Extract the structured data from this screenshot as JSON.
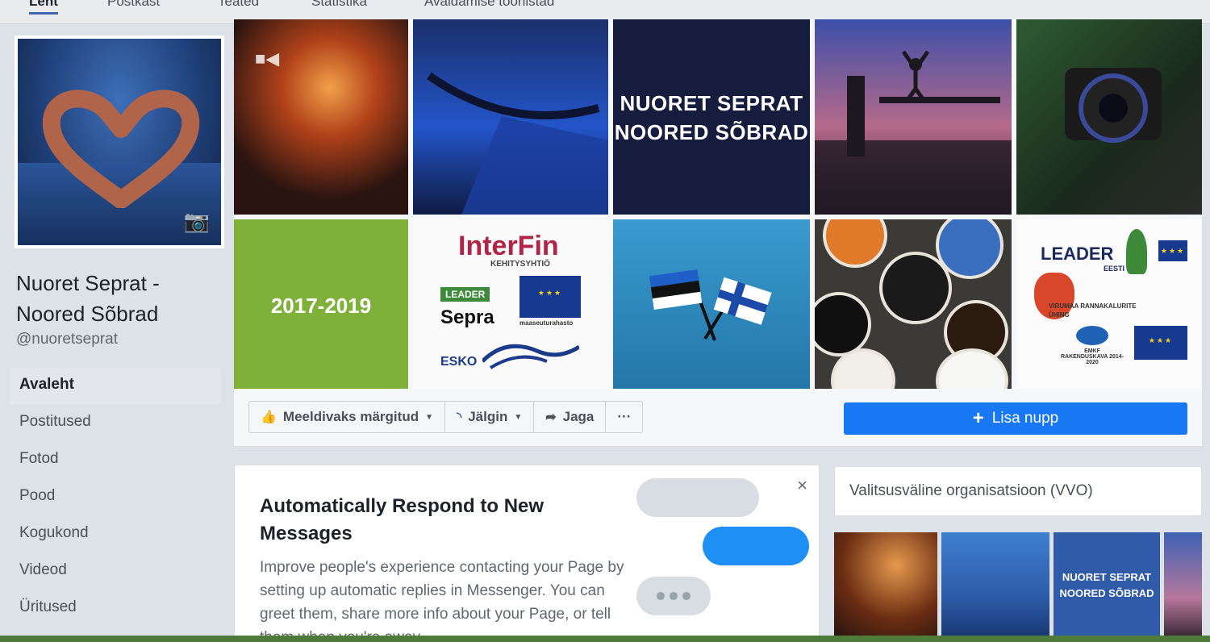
{
  "top_tabs": [
    "Lent",
    "Postkast",
    "Teated",
    "Statistika",
    "Avaldamise tööriistad"
  ],
  "page": {
    "name": "Nuoret Seprat - Noored Sõbrad",
    "handle": "@nuoretseprat"
  },
  "nav": [
    "Avaleht",
    "Postitused",
    "Fotod",
    "Pood",
    "Kogukond",
    "Videod",
    "Üritused"
  ],
  "cover": {
    "title_line1": "NUORET SEPRAT",
    "title_line2": "NOORED SÕBRAD",
    "years": "2017-2019",
    "logos": {
      "interfin": "InterFin",
      "interfin_sub": "KEHITYSYHTIÖ",
      "leader": "LEADER",
      "sepra": "Sepra",
      "eu_fund": "maaseuturahasto",
      "esko": "ESKO",
      "leader_eesti": "LEADER",
      "eesti": "EESTI",
      "virumaa": "VIRUMAA RANNAKALURITE ÜHING",
      "emkf": "EMKF RAKENDUSKAVA 2014-2020"
    }
  },
  "actions": {
    "like": "Meeldivaks märgitud",
    "follow": "Jälgin",
    "share": "Jaga",
    "more": "···",
    "add_button": "Lisa nupp"
  },
  "message_card": {
    "title": "Automatically Respond to New Messages",
    "body": "Improve people's experience contacting your Page by setting up automatic replies in Messenger. You can greet them, share more info about your Page, or tell them when you're away."
  },
  "category": "Valitsusväline organisatsioon (VVO)",
  "thumb_text": {
    "line1": "NUORET SEPRAT",
    "line2": "NOORED SÕBRAD"
  },
  "colors": {
    "accent": "#1877f2",
    "brand_blue": "#4267b2",
    "green_tile": "#7fb13a"
  }
}
